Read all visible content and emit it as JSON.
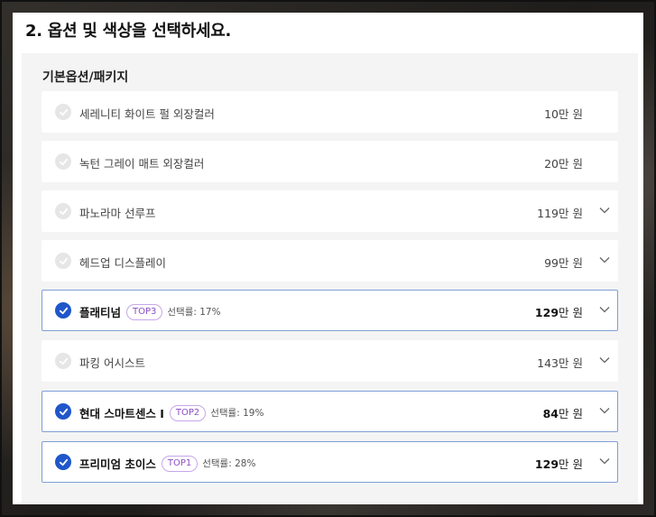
{
  "heading": "2. 옵션 및 색상을 선택하세요.",
  "group_title": "기본옵션/패키지",
  "unit": "만 원",
  "colors": {
    "accent": "#1f56c9",
    "selected_border": "#7f9fd6",
    "badge": "#8a4fc5"
  },
  "options": [
    {
      "label": "세레니티 화이트 펄 외장컬러",
      "price": "10",
      "selected": false,
      "expandable": false
    },
    {
      "label": "녹턴 그레이 매트 외장컬러",
      "price": "20",
      "selected": false,
      "expandable": false
    },
    {
      "label": "파노라마 선루프",
      "price": "119",
      "selected": false,
      "expandable": true
    },
    {
      "label": "헤드업 디스플레이",
      "price": "99",
      "selected": false,
      "expandable": true
    },
    {
      "label": "플래티넘",
      "badge": "TOP3",
      "rate": "선택률: 17%",
      "price": "129",
      "selected": true,
      "expandable": true
    },
    {
      "label": "파킹 어시스트",
      "price": "143",
      "selected": false,
      "expandable": true
    },
    {
      "label": "현대 스마트센스 I",
      "badge": "TOP2",
      "rate": "선택률: 19%",
      "price": "84",
      "selected": true,
      "expandable": true
    },
    {
      "label": "프리미엄 초이스",
      "badge": "TOP1",
      "rate": "선택률: 28%",
      "price": "129",
      "selected": true,
      "expandable": true
    }
  ]
}
